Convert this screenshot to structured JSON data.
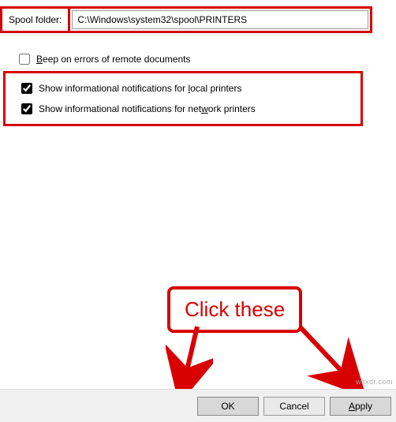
{
  "spool": {
    "label": "Spool folder:",
    "value": "C:\\Windows\\system32\\spool\\PRINTERS"
  },
  "options": {
    "beep": {
      "checked": false,
      "label_pre": "",
      "label_u": "B",
      "label_post": "eep on errors of remote documents"
    },
    "local": {
      "checked": true,
      "label_pre": "Show informational notifications for ",
      "label_u": "l",
      "label_post": "ocal printers"
    },
    "network": {
      "checked": true,
      "label_pre": "Show informational notifications for net",
      "label_u": "w",
      "label_post": "ork printers"
    }
  },
  "callout": {
    "text": "Click these"
  },
  "buttons": {
    "ok": "OK",
    "cancel": "Cancel",
    "apply_u": "A",
    "apply_post": "pply"
  },
  "watermark": "wsxdr.com"
}
